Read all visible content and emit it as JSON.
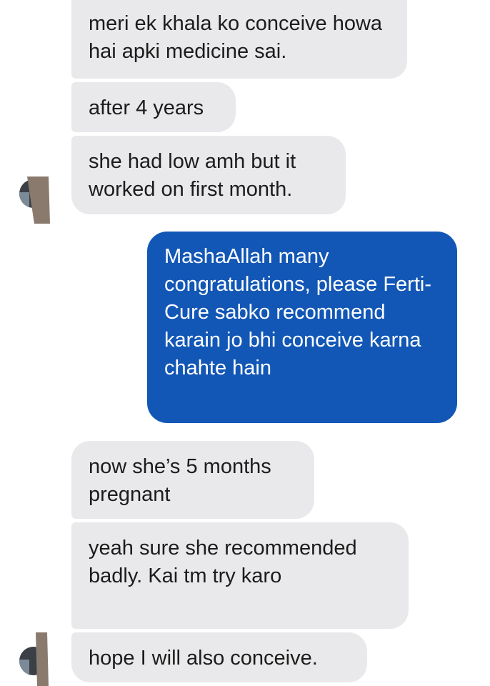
{
  "messages": [
    {
      "id": "m1",
      "direction": "incoming",
      "text": "meri ek khala ko conceive howa hai apki medicine sai."
    },
    {
      "id": "m2",
      "direction": "incoming",
      "text": "after 4 years"
    },
    {
      "id": "m3",
      "direction": "incoming",
      "text": "she had low amh but it worked on first month."
    },
    {
      "id": "m4",
      "direction": "outgoing",
      "text": "MashaAllah many congratulations, please Ferti-Cure sabko recommend karain jo bhi conceive karna chahte hain"
    },
    {
      "id": "m5",
      "direction": "incoming",
      "text": "now she’s 5 months pregnant"
    },
    {
      "id": "m6",
      "direction": "incoming",
      "text": "yeah sure she recommended badly. Kai tm try karo"
    },
    {
      "id": "m7",
      "direction": "incoming",
      "text": "hope I will also conceive."
    }
  ],
  "colors": {
    "incoming_bubble": "#e9e9eb",
    "outgoing_bubble": "#1257b6",
    "incoming_text": "#1c1c1c",
    "outgoing_text": "#ffffff"
  },
  "icons": {
    "avatar": "blurred-profile-picture"
  }
}
